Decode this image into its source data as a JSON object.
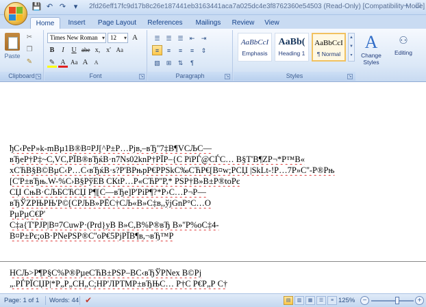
{
  "titlebar": {
    "title": "2fd26eff17fc9d17b8c26e187441eb3163441aca7a025dc4e3f8762360e54503 (Read-Only) [Compatibility Mode] - Mi",
    "qat": [
      "save-icon",
      "undo-icon",
      "redo-icon",
      "customize-icon"
    ]
  },
  "tabs": [
    "Home",
    "Insert",
    "Page Layout",
    "References",
    "Mailings",
    "Review",
    "View"
  ],
  "ribbon": {
    "clipboard": {
      "paste_label": "Paste",
      "group_label": "Clipboard"
    },
    "font": {
      "font_name": "Times New Roman",
      "font_size": "12",
      "group_label": "Font",
      "buttons_row1": [
        "A",
        "A"
      ],
      "buttons_row2": [
        "B",
        "I",
        "U",
        "abe",
        "x,",
        "x'",
        "Aa"
      ],
      "buttons_row3": [
        "A",
        "Aa",
        "A",
        "A"
      ]
    },
    "paragraph": {
      "group_label": "Paragraph"
    },
    "styles": {
      "group_label": "Styles",
      "tiles": [
        {
          "sample": "AaBbCcI",
          "name": "Emphasis"
        },
        {
          "sample": "AaBb(",
          "name": "Heading 1"
        },
        {
          "sample": "AaBbCcI",
          "name": "¶ Normal"
        }
      ],
      "change_styles_label_1": "Change",
      "change_styles_label_2": "Styles"
    },
    "editing": {
      "label": "Editing"
    }
  },
  "document": {
    "lines": [
      "ђС‹РеР»k-mBµ1B®B¤PJ[^P±P…Pјв,–вЂ''7‡В¶VCЉС—",
      "вЂеР†Р‡~С,VC,РЇВ®вЂќВ·n7Ns02knP†РЇР–{С   РїРЃ@СЃС…  В§Т'В¶ZР¬*Р™В«",
      "хСЋВ§В©ВµС‹Р…С‹вЂќВ·s?Р'ВРњрР€PРSkC‰СЋР€[В¤w;PСЏ  |SkLt-!P…7P»C''-Р®Рњ",
      "[С'Р±вЂњ.W-%С›В§РўЕВ СКtР…Р«СЋР''Р,* PSP†В»В±Р®toРє",
      "СЏ СњВ·СЉБСЋСЏ Р¶[С—вЂе]Р'РiР¶?*Р›С…Р¬Р—",
      "вЂЎZРЊРЊ'Р©[СРЉВ»РЁС†СЉ«В»С‡в,,ўјGnР°С…О",
      "РµРµС€Р'",
      "С‡а{Т'PJР|В¤7СuwР·(Рrd}уВ В»С,В%Р®вЂ  В»''Р%oС‡4-",
      "В¤Р±Рє;оВ·РNеPSP®С''оР€5РјРЇВ¶в,¬вЂ™Р"
    ],
    "lines_page2": [
      "НСЉ>Р¶Р§С%Р®РµеСЋВ±PSP–ВС‹вЂЎPNеx  В©Рj",
      "„.РЃРЇСЏР|*Р„Р„СН„С;НР'ЛРТМР±вЂЊС…  Р†С    Р€Р„Р  С†"
    ]
  },
  "statusbar": {
    "page": "Page: 1 of 1",
    "words": "Words: 44",
    "zoom": "125%",
    "zoom_fraction": 0.62
  },
  "colors": {
    "accent": "#15428b",
    "ribbon_bg": "#dbe8f7",
    "selected": "#ffc84a"
  }
}
